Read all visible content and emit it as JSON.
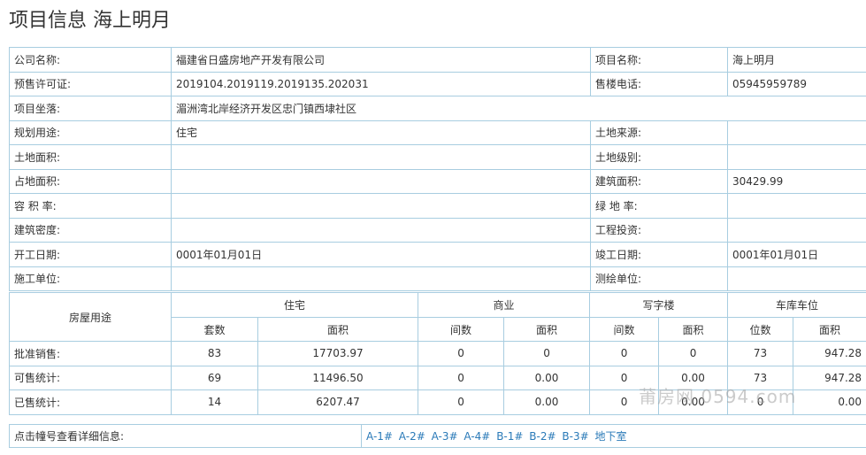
{
  "title": "项目信息 海上明月",
  "info": {
    "company_label": "公司名称:",
    "company_value": "福建省日盛房地产开发有限公司",
    "project_label": "项目名称:",
    "project_value": "海上明月",
    "permit_label": "预售许可证:",
    "permit_value": "2019104.2019119.2019135.202031",
    "phone_label": "售楼电话:",
    "phone_value": "05945959789",
    "location_label": "项目坐落:",
    "location_value": "湄洲湾北岸经济开发区忠门镇西埭社区",
    "usage_label": "规划用途:",
    "usage_value": "住宅",
    "land_source_label": "土地来源:",
    "land_source_value": "",
    "land_area_label": "土地面积:",
    "land_area_value": "",
    "land_grade_label": "土地级别:",
    "land_grade_value": "",
    "occupied_area_label": "占地面积:",
    "occupied_area_value": "",
    "building_area_label": "建筑面积:",
    "building_area_value": "30429.99",
    "plot_ratio_label": "容 积 率:",
    "plot_ratio_value": "",
    "green_ratio_label": "绿 地 率:",
    "green_ratio_value": "",
    "density_label": "建筑密度:",
    "density_value": "",
    "investment_label": "工程投资:",
    "investment_value": "",
    "start_date_label": "开工日期:",
    "start_date_value": "0001年01月01日",
    "finish_date_label": "竣工日期:",
    "finish_date_value": "0001年01月01日",
    "builder_label": "施工单位:",
    "builder_value": "",
    "surveyor_label": "测绘单位:",
    "surveyor_value": ""
  },
  "stats": {
    "row_header": "房屋用途",
    "groups": {
      "residential": "住宅",
      "commercial": "商业",
      "office": "写字楼",
      "garage": "车库车位"
    },
    "sub": {
      "res_count": "套数",
      "res_area": "面积",
      "com_count": "间数",
      "com_area": "面积",
      "off_count": "间数",
      "off_area": "面积",
      "gar_count": "位数",
      "gar_area": "面积"
    },
    "rows": [
      {
        "label": "批准销售:",
        "res_count": "83",
        "res_area": "17703.97",
        "com_count": "0",
        "com_area": "0",
        "off_count": "0",
        "off_area": "0",
        "gar_count": "73",
        "gar_area": "947.28"
      },
      {
        "label": "可售统计:",
        "res_count": "69",
        "res_area": "11496.50",
        "com_count": "0",
        "com_area": "0.00",
        "off_count": "0",
        "off_area": "0.00",
        "gar_count": "73",
        "gar_area": "947.28"
      },
      {
        "label": "已售统计:",
        "res_count": "14",
        "res_area": "6207.47",
        "com_count": "0",
        "com_area": "0.00",
        "off_count": "0",
        "off_area": "0.00",
        "gar_count": "0",
        "gar_area": "0.00"
      }
    ]
  },
  "links": {
    "label": "点击幢号查看详细信息:",
    "buildings": [
      "A-1#",
      "A-2#",
      "A-3#",
      "A-4#",
      "B-1#",
      "B-2#",
      "B-3#",
      "地下室"
    ]
  },
  "watermark": "莆房网 0594.com"
}
